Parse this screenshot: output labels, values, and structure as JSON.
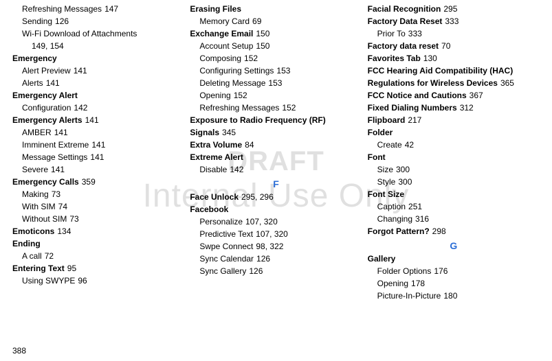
{
  "pageNumber": "388",
  "watermark": {
    "draft": "DRAFT",
    "sub": "Internal Use Only"
  },
  "columns": [
    {
      "items": [
        {
          "kind": "entry",
          "level": 1,
          "label": "Refreshing Messages",
          "pages": "147"
        },
        {
          "kind": "entry",
          "level": 1,
          "label": "Sending",
          "pages": "126"
        },
        {
          "kind": "entry",
          "level": 1,
          "label": "Wi-Fi Download of Attachments",
          "pages": ""
        },
        {
          "kind": "entry",
          "level": 2,
          "label": "149, 154",
          "pages": ""
        },
        {
          "kind": "entry",
          "level": 0,
          "label": "Emergency",
          "pages": ""
        },
        {
          "kind": "entry",
          "level": 1,
          "label": "Alert Preview",
          "pages": "141"
        },
        {
          "kind": "entry",
          "level": 1,
          "label": "Alerts",
          "pages": "141"
        },
        {
          "kind": "entry",
          "level": 0,
          "label": "Emergency Alert",
          "pages": ""
        },
        {
          "kind": "entry",
          "level": 1,
          "label": "Configuration",
          "pages": "142"
        },
        {
          "kind": "entry",
          "level": 0,
          "label": "Emergency Alerts",
          "pages": "141"
        },
        {
          "kind": "entry",
          "level": 1,
          "label": "AMBER",
          "pages": "141"
        },
        {
          "kind": "entry",
          "level": 1,
          "label": "Imminent Extreme",
          "pages": "141"
        },
        {
          "kind": "entry",
          "level": 1,
          "label": "Message Settings",
          "pages": "141"
        },
        {
          "kind": "entry",
          "level": 1,
          "label": "Severe",
          "pages": "141"
        },
        {
          "kind": "entry",
          "level": 0,
          "label": "Emergency Calls",
          "pages": "359"
        },
        {
          "kind": "entry",
          "level": 1,
          "label": "Making",
          "pages": "73"
        },
        {
          "kind": "entry",
          "level": 1,
          "label": "With SIM",
          "pages": "74"
        },
        {
          "kind": "entry",
          "level": 1,
          "label": "Without SIM",
          "pages": "73"
        },
        {
          "kind": "entry",
          "level": 0,
          "label": "Emoticons",
          "pages": "134"
        },
        {
          "kind": "entry",
          "level": 0,
          "label": "Ending",
          "pages": ""
        },
        {
          "kind": "entry",
          "level": 1,
          "label": "A call",
          "pages": "72"
        },
        {
          "kind": "entry",
          "level": 0,
          "label": "Entering Text",
          "pages": "95"
        },
        {
          "kind": "entry",
          "level": 1,
          "label": "Using SWYPE",
          "pages": "96"
        }
      ]
    },
    {
      "items": [
        {
          "kind": "entry",
          "level": 0,
          "label": "Erasing Files",
          "pages": ""
        },
        {
          "kind": "entry",
          "level": 1,
          "label": "Memory Card",
          "pages": "69"
        },
        {
          "kind": "entry",
          "level": 0,
          "label": "Exchange Email",
          "pages": "150"
        },
        {
          "kind": "entry",
          "level": 1,
          "label": "Account Setup",
          "pages": "150"
        },
        {
          "kind": "entry",
          "level": 1,
          "label": "Composing",
          "pages": "152"
        },
        {
          "kind": "entry",
          "level": 1,
          "label": "Configuring Settings",
          "pages": "153"
        },
        {
          "kind": "entry",
          "level": 1,
          "label": "Deleting Message",
          "pages": "153"
        },
        {
          "kind": "entry",
          "level": 1,
          "label": "Opening",
          "pages": "152"
        },
        {
          "kind": "entry",
          "level": 1,
          "label": "Refreshing Messages",
          "pages": "152"
        },
        {
          "kind": "entry",
          "level": 0,
          "label": "Exposure to Radio Frequency (RF) Signals",
          "pages": "345"
        },
        {
          "kind": "entry",
          "level": 0,
          "label": "Extra Volume",
          "pages": "84"
        },
        {
          "kind": "entry",
          "level": 0,
          "label": "Extreme Alert",
          "pages": ""
        },
        {
          "kind": "entry",
          "level": 1,
          "label": "Disable",
          "pages": "142"
        },
        {
          "kind": "letter",
          "label": "F"
        },
        {
          "kind": "entry",
          "level": 0,
          "label": "Face Unlock",
          "pages": "295, 296"
        },
        {
          "kind": "entry",
          "level": 0,
          "label": "Facebook",
          "pages": ""
        },
        {
          "kind": "entry",
          "level": 1,
          "label": "Personalize",
          "pages": "107, 320"
        },
        {
          "kind": "entry",
          "level": 1,
          "label": "Predictive Text",
          "pages": "107, 320"
        },
        {
          "kind": "entry",
          "level": 1,
          "label": "Swpe Connect",
          "pages": "98, 322"
        },
        {
          "kind": "entry",
          "level": 1,
          "label": "Sync Calendar",
          "pages": "126"
        },
        {
          "kind": "entry",
          "level": 1,
          "label": "Sync Gallery",
          "pages": "126"
        }
      ]
    },
    {
      "items": [
        {
          "kind": "entry",
          "level": 0,
          "label": "Facial Recognition",
          "pages": "295"
        },
        {
          "kind": "entry",
          "level": 0,
          "label": "Factory Data Reset",
          "pages": "333"
        },
        {
          "kind": "entry",
          "level": 1,
          "label": "Prior To",
          "pages": "333"
        },
        {
          "kind": "entry",
          "level": 0,
          "label": "Factory data reset",
          "pages": "70"
        },
        {
          "kind": "entry",
          "level": 0,
          "label": "Favorites Tab",
          "pages": "130"
        },
        {
          "kind": "entry",
          "level": 0,
          "label": "FCC Hearing Aid Compatibility (HAC) Regulations for Wireless Devices",
          "pages": "365"
        },
        {
          "kind": "entry",
          "level": 0,
          "label": "FCC Notice and Cautions",
          "pages": "367"
        },
        {
          "kind": "entry",
          "level": 0,
          "label": "Fixed Dialing Numbers",
          "pages": "312"
        },
        {
          "kind": "entry",
          "level": 0,
          "label": "Flipboard",
          "pages": "217"
        },
        {
          "kind": "entry",
          "level": 0,
          "label": "Folder",
          "pages": ""
        },
        {
          "kind": "entry",
          "level": 1,
          "label": "Create",
          "pages": "42"
        },
        {
          "kind": "entry",
          "level": 0,
          "label": "Font",
          "pages": ""
        },
        {
          "kind": "entry",
          "level": 1,
          "label": "Size",
          "pages": "300"
        },
        {
          "kind": "entry",
          "level": 1,
          "label": "Style",
          "pages": "300"
        },
        {
          "kind": "entry",
          "level": 0,
          "label": "Font Size",
          "pages": ""
        },
        {
          "kind": "entry",
          "level": 1,
          "label": "Caption",
          "pages": "251"
        },
        {
          "kind": "entry",
          "level": 1,
          "label": "Changing",
          "pages": "316"
        },
        {
          "kind": "entry",
          "level": 0,
          "label": "Forgot Pattern?",
          "pages": "298"
        },
        {
          "kind": "letter",
          "label": "G"
        },
        {
          "kind": "entry",
          "level": 0,
          "label": "Gallery",
          "pages": ""
        },
        {
          "kind": "entry",
          "level": 1,
          "label": "Folder Options",
          "pages": "176"
        },
        {
          "kind": "entry",
          "level": 1,
          "label": "Opening",
          "pages": "178"
        },
        {
          "kind": "entry",
          "level": 1,
          "label": "Picture-In-Picture",
          "pages": "180"
        }
      ]
    }
  ]
}
